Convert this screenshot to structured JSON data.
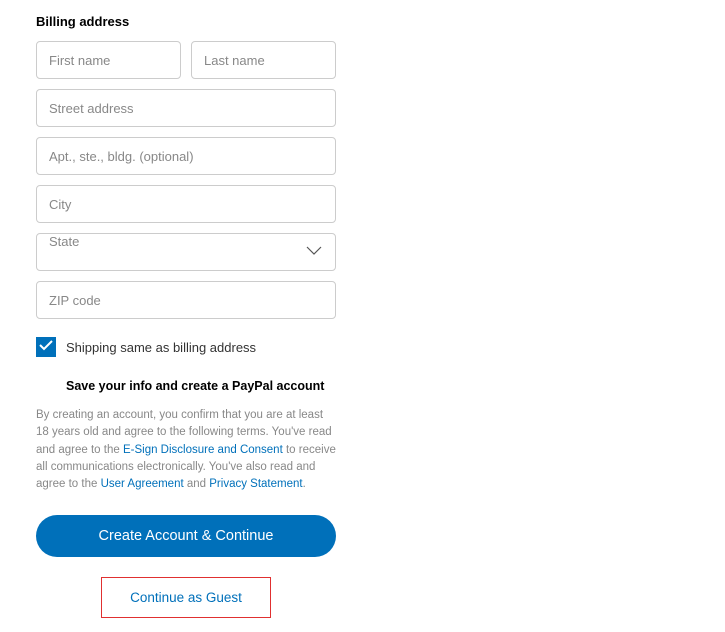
{
  "heading": "Billing address",
  "fields": {
    "first_name_placeholder": "First name",
    "last_name_placeholder": "Last name",
    "street_placeholder": "Street address",
    "apt_placeholder": "Apt., ste., bldg. (optional)",
    "city_placeholder": "City",
    "state_label": "State",
    "zip_placeholder": "ZIP code"
  },
  "checkbox": {
    "checked": true,
    "label": "Shipping same as billing address"
  },
  "subheading": "Save your info and create a PayPal account",
  "terms": {
    "part1": "By creating an account, you confirm that you are at least 18 years old and agree to the following terms. You've read and agree to the ",
    "link1": "E-Sign Disclosure and Consent",
    "part2": " to receive all communications electronically. You've also read and agree to the ",
    "link2": "User Agreement",
    "part3": " and ",
    "link3": "Privacy Statement",
    "part4": "."
  },
  "buttons": {
    "create": "Create Account & Continue",
    "guest": "Continue as Guest"
  }
}
